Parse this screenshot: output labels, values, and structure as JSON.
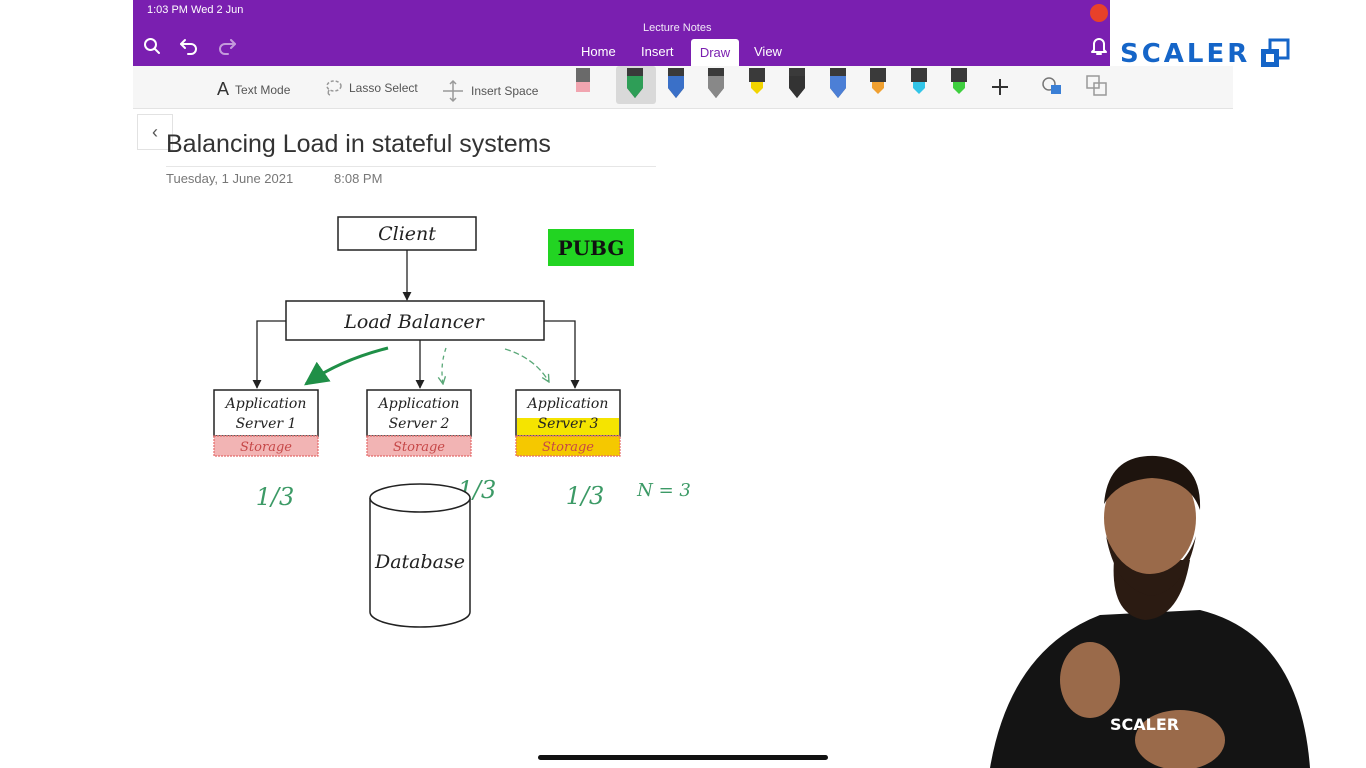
{
  "status_bar": {
    "time": "1:03 PM  Wed 2 Jun"
  },
  "app": {
    "document_title": "Lecture Notes"
  },
  "ribbon": {
    "tabs": [
      {
        "label": "Home"
      },
      {
        "label": "Insert"
      },
      {
        "label": "Draw"
      },
      {
        "label": "View"
      }
    ],
    "active_tab": "Draw"
  },
  "toolbar": {
    "text_mode": "Text Mode",
    "lasso_select": "Lasso Select",
    "insert_space": "Insert Space",
    "pens": [
      {
        "icon": "pen-icon",
        "color": "#2e9e57"
      },
      {
        "icon": "pen-icon",
        "color": "#3a70c8"
      },
      {
        "icon": "pen-icon",
        "color": "#888888"
      },
      {
        "icon": "highlighter-icon",
        "color": "#f2d400"
      },
      {
        "icon": "pen-icon",
        "color": "#333333"
      },
      {
        "icon": "pen-icon",
        "color": "#4c7fd6"
      },
      {
        "icon": "highlighter-icon",
        "color": "#f0a030"
      },
      {
        "icon": "highlighter-icon",
        "color": "#32c5e8"
      },
      {
        "icon": "highlighter-icon",
        "color": "#3fcf3f"
      }
    ]
  },
  "brand": {
    "name": "SCALER",
    "color": "#1565c8"
  },
  "page": {
    "title": "Balancing Load in stateful systems",
    "date": "Tuesday, 1 June 2021",
    "time": "8:08 PM"
  },
  "diagram": {
    "client": "Client",
    "load_balancer": "Load Balancer",
    "tag": "PUBG",
    "servers": [
      {
        "line1": "Application",
        "line2": "Server 1",
        "storage": "Storage",
        "share": "1/3"
      },
      {
        "line1": "Application",
        "line2": "Server 2",
        "storage": "Storage",
        "share": "1/3"
      },
      {
        "line1": "Application",
        "line2": "Server 3",
        "storage": "Storage",
        "share": "1/3"
      }
    ],
    "n_label": "N = 3",
    "database": "Database"
  },
  "colors": {
    "ribbon_purple": "#7a1fb0",
    "ink_green": "#2e9e57",
    "storage_red": "#e46a6a",
    "storage_yellow": "#f5d400",
    "tag_green": "#22d422"
  }
}
